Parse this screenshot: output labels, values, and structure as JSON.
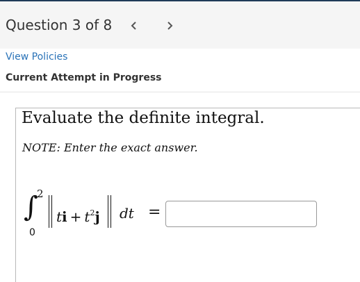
{
  "header": {
    "question_counter": "Question 3 of 8",
    "prev_icon": "chevron-left-icon",
    "next_icon": "chevron-right-icon"
  },
  "links": {
    "view_policies": "View Policies"
  },
  "status": {
    "attempt_label": "Current Attempt in Progress"
  },
  "question": {
    "prompt": "Evaluate the definite integral.",
    "note": "NOTE:  Enter the exact answer.",
    "integral": {
      "lower_limit": "0",
      "upper_limit": "2",
      "integrand_t": "t",
      "vector_i": "i",
      "plus": "+",
      "t_squared_base": "t",
      "t_squared_exp": "2",
      "vector_j": "j",
      "differential": "dt",
      "equals": "="
    },
    "answer": {
      "value": "",
      "placeholder": ""
    }
  },
  "colors": {
    "link": "#2a73b8",
    "top_rule": "#1f3b58",
    "header_band": "#f5f5f5"
  }
}
